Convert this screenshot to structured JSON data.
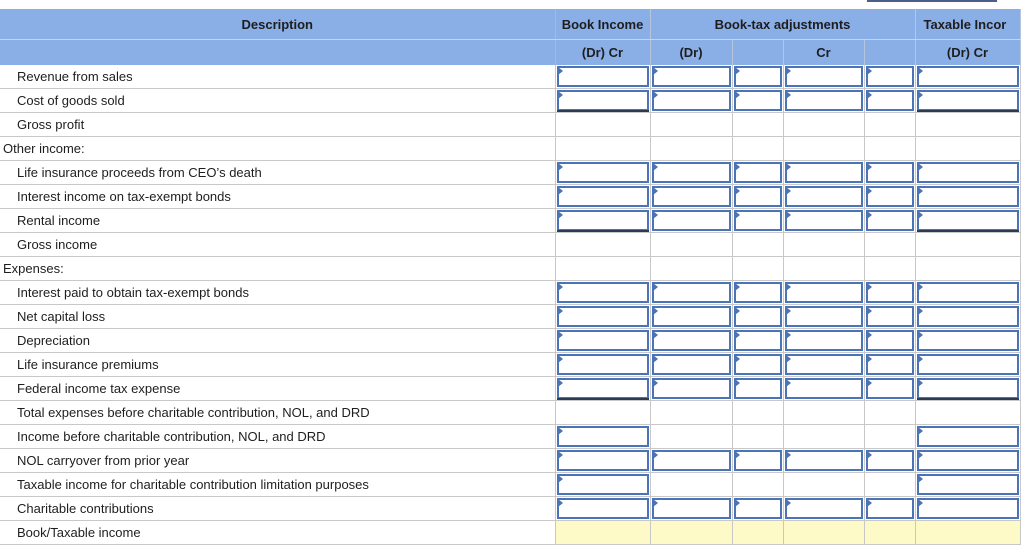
{
  "headers": {
    "description": "Description",
    "book_income": "Book Income",
    "book_tax_adjustments": "Book-tax adjustments",
    "taxable_income": "Taxable Incor",
    "book_sub": "(Dr) Cr",
    "dr_sub": "(Dr)",
    "cr_sub": "Cr",
    "taxable_sub": "(Dr) Cr"
  },
  "rows": [
    {
      "label": "Revenue from sales",
      "type": "input"
    },
    {
      "label": "Cost of goods sold",
      "type": "input-sum"
    },
    {
      "label": "Gross profit",
      "type": "empty"
    },
    {
      "label": "Other income:",
      "type": "section"
    },
    {
      "label": "Life insurance proceeds from CEO’s death",
      "type": "input"
    },
    {
      "label": "Interest income on tax-exempt bonds",
      "type": "input"
    },
    {
      "label": "Rental income",
      "type": "input-sum"
    },
    {
      "label": "Gross income",
      "type": "empty"
    },
    {
      "label": "Expenses:",
      "type": "section"
    },
    {
      "label": "Interest paid to obtain tax-exempt bonds",
      "type": "input"
    },
    {
      "label": "Net capital loss",
      "type": "input"
    },
    {
      "label": "Depreciation",
      "type": "input"
    },
    {
      "label": "Life insurance premiums",
      "type": "input"
    },
    {
      "label": "Federal income tax expense",
      "type": "input-sum"
    },
    {
      "label": "Total expenses before charitable contribution, NOL, and DRD",
      "type": "empty"
    },
    {
      "label": "Income before charitable contribution, NOL, and DRD",
      "type": "input-partial"
    },
    {
      "label": "NOL carryover from prior year",
      "type": "input"
    },
    {
      "label": "Taxable income for charitable contribution limitation purposes",
      "type": "input-partial"
    },
    {
      "label": "Charitable contributions",
      "type": "input"
    },
    {
      "label": "Book/Taxable income",
      "type": "yellow"
    }
  ]
}
